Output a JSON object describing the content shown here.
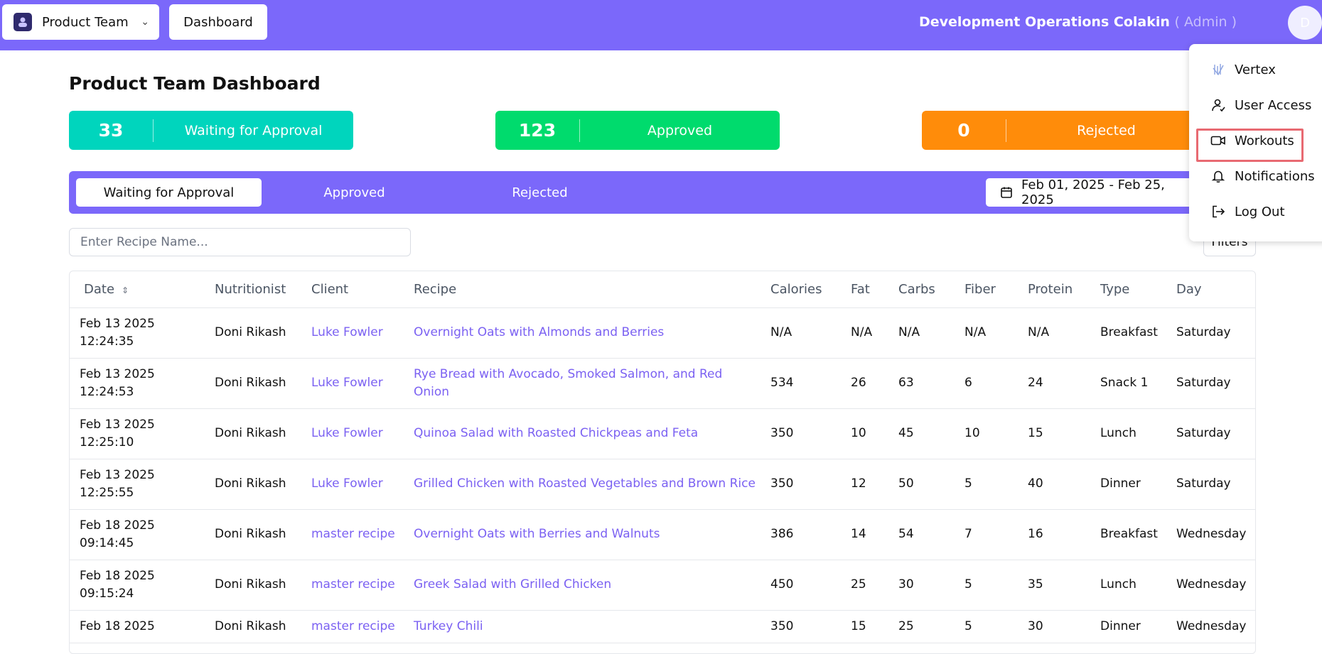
{
  "header": {
    "team_label": "Product Team",
    "dashboard_label": "Dashboard",
    "user_name": "Development Operations Colakin",
    "user_role": "( Admin )",
    "avatar_initial": "D"
  },
  "page": {
    "title": "Product Team Dashboard"
  },
  "stats": {
    "waiting": {
      "count": "33",
      "label": "Waiting for Approval",
      "color": "#00d5bd"
    },
    "approved": {
      "count": "123",
      "label": "Approved",
      "color": "#00db6d"
    },
    "rejected": {
      "count": "0",
      "label": "Rejected",
      "color": "#ff8c0a"
    }
  },
  "tabs": {
    "waiting": "Waiting for Approval",
    "approved": "Approved",
    "rejected": "Rejected"
  },
  "date_range": "Feb 01, 2025 - Feb 25, 2025",
  "search": {
    "placeholder": "Enter Recipe Name..."
  },
  "filters_label": "Filters",
  "table": {
    "headers": [
      "Date",
      "Nutritionist",
      "Client",
      "Recipe",
      "Calories",
      "Fat",
      "Carbs",
      "Fiber",
      "Protein",
      "Type",
      "Day"
    ],
    "rows": [
      [
        "Feb 13 2025 12:24:35",
        "Doni Rikash",
        "Luke Fowler",
        "Overnight Oats with Almonds and Berries",
        "N/A",
        "N/A",
        "N/A",
        "N/A",
        "N/A",
        "Breakfast",
        "Saturday"
      ],
      [
        "Feb 13 2025 12:24:53",
        "Doni Rikash",
        "Luke Fowler",
        "Rye Bread with Avocado, Smoked Salmon, and Red Onion",
        "534",
        "26",
        "63",
        "6",
        "24",
        "Snack 1",
        "Saturday"
      ],
      [
        "Feb 13 2025 12:25:10",
        "Doni Rikash",
        "Luke Fowler",
        "Quinoa Salad with Roasted Chickpeas and Feta",
        "350",
        "10",
        "45",
        "10",
        "15",
        "Lunch",
        "Saturday"
      ],
      [
        "Feb 13 2025 12:25:55",
        "Doni Rikash",
        "Luke Fowler",
        "Grilled Chicken with Roasted Vegetables and Brown Rice",
        "350",
        "12",
        "50",
        "5",
        "40",
        "Dinner",
        "Saturday"
      ],
      [
        "Feb 18 2025 09:14:45",
        "Doni Rikash",
        "master recipe",
        "Overnight Oats with Berries and Walnuts",
        "386",
        "14",
        "54",
        "7",
        "16",
        "Breakfast",
        "Wednesday"
      ],
      [
        "Feb 18 2025 09:15:24",
        "Doni Rikash",
        "master recipe",
        "Greek Salad with Grilled Chicken",
        "450",
        "25",
        "30",
        "5",
        "35",
        "Lunch",
        "Wednesday"
      ],
      [
        "Feb 18 2025",
        "Doni Rikash",
        "master recipe",
        "Turkey Chili",
        "350",
        "15",
        "25",
        "5",
        "30",
        "Dinner",
        "Wednesday"
      ]
    ]
  },
  "menu": {
    "items": [
      "Vertex",
      "User Access",
      "Workouts",
      "Notifications",
      "Log Out"
    ]
  },
  "colors": {
    "primary": "#7b68fa",
    "link": "#7b61f2",
    "highlight": "#e86a72"
  }
}
